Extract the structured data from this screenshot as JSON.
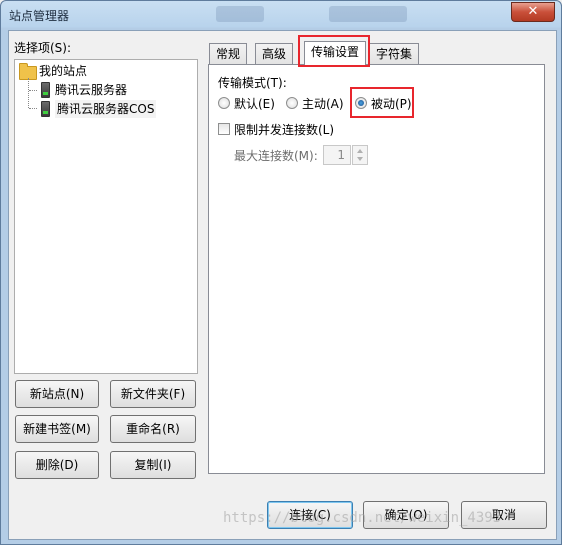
{
  "window": {
    "title": "站点管理器",
    "close_glyph": "✕"
  },
  "left": {
    "select_label": "选择项(S):",
    "tree": {
      "root": "我的站点",
      "children": [
        "腾讯云服务器",
        "腾讯云服务器COS"
      ]
    },
    "buttons": {
      "new_site": "新站点(N)",
      "new_folder": "新文件夹(F)",
      "new_bookmark": "新建书签(M)",
      "rename": "重命名(R)",
      "delete": "删除(D)",
      "copy": "复制(I)"
    }
  },
  "tabs": [
    "常规",
    "高级",
    "传输设置",
    "字符集"
  ],
  "active_tab": "传输设置",
  "transfer": {
    "mode_label": "传输模式(T):",
    "modes": [
      "默认(E)",
      "主动(A)",
      "被动(P)"
    ],
    "selected_mode": "被动(P)",
    "limit_label": "限制并发连接数(L)",
    "limit_checked": false,
    "max_conn_label": "最大连接数(M):",
    "max_conn_value": "1"
  },
  "footer": {
    "connect": "连接(C)",
    "ok": "确定(O)",
    "cancel": "取消"
  },
  "watermark": "https://blog.csdn.net/weixin_4393",
  "highlight_color": "#e8262d"
}
